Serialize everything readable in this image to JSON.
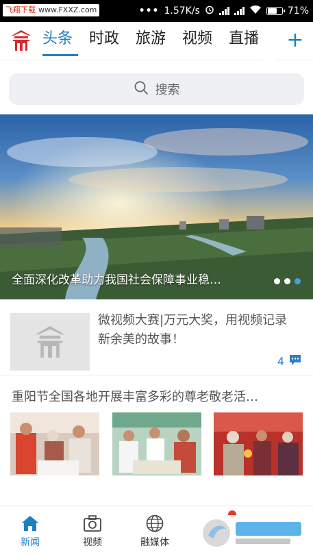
{
  "status_bar": {
    "watermark": "飞翔下载",
    "watermark_url": "www.FXXZ.com",
    "network_speed": "1.57K/s",
    "battery": "71%",
    "battery_level": 0.71
  },
  "header": {
    "tabs": [
      {
        "label": "头条",
        "active": true
      },
      {
        "label": "时政",
        "active": false
      },
      {
        "label": "旅游",
        "active": false
      },
      {
        "label": "视频",
        "active": false
      },
      {
        "label": "直播",
        "active": false
      }
    ],
    "add_label": "+"
  },
  "search": {
    "placeholder": "搜索"
  },
  "banner": {
    "caption": "全面深化改革助力我国社会保障事业稳…",
    "page_count": 3,
    "active_page": 3
  },
  "news": [
    {
      "title": "微视频大赛|万元大奖，用视频记录新余美的故事！",
      "comment_count": "4"
    },
    {
      "title": "重阳节全国各地开展丰富多彩的尊老敬老活…"
    }
  ],
  "bottom_nav": {
    "items": [
      {
        "label": "新闻",
        "icon": "home-icon",
        "active": true
      },
      {
        "label": "视频",
        "icon": "camera-icon",
        "active": false
      },
      {
        "label": "融媒体",
        "icon": "globe-icon",
        "active": false
      }
    ]
  },
  "colors": {
    "accent": "#1f7fc3",
    "logo_red": "#d6282e",
    "text": "#333333"
  }
}
